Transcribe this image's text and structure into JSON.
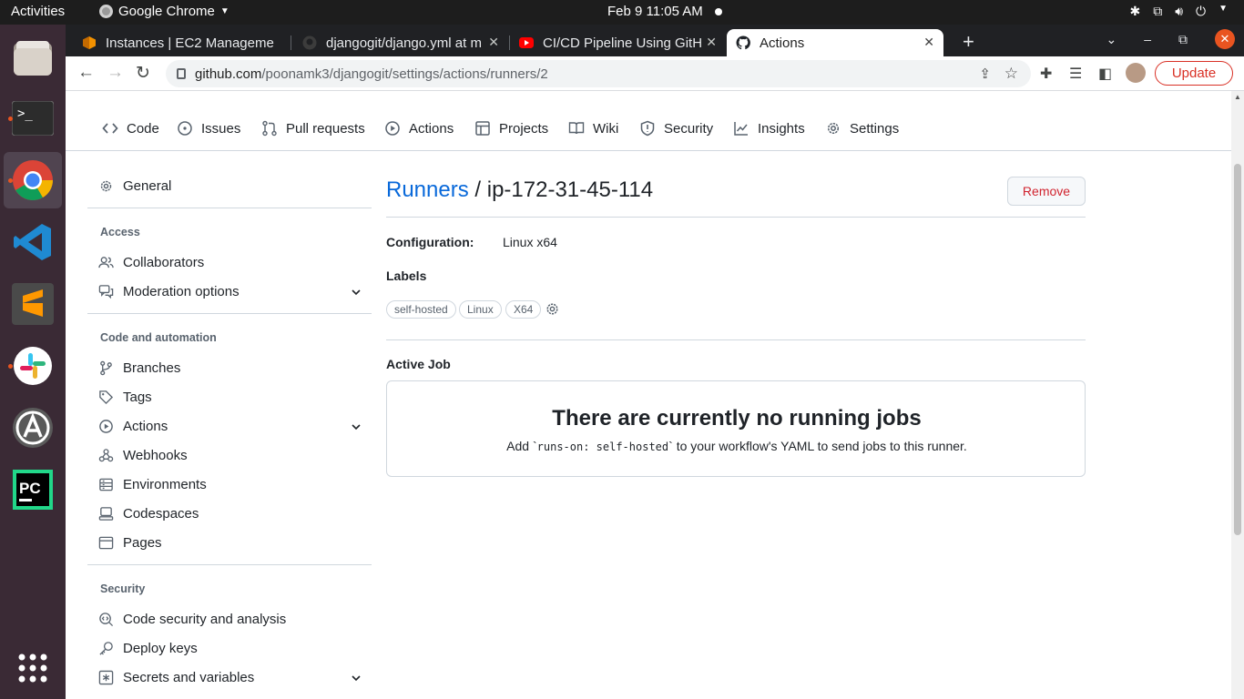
{
  "os": {
    "activities": "Activities",
    "app_menu": "Google Chrome",
    "clock": "Feb 9  11:05 AM",
    "dock": [
      "Files",
      "Terminal",
      "Google Chrome",
      "Visual Studio Code",
      "Sublime Text",
      "Slack",
      "Ubuntu Software",
      "PyCharm",
      "Show Applications"
    ]
  },
  "browser": {
    "tabs": [
      {
        "title": "Instances | EC2 Manageme",
        "icon": "aws-icon"
      },
      {
        "title": "djangogit/django.yml at m",
        "icon": "github-icon"
      },
      {
        "title": "CI/CD Pipeline Using GitH",
        "icon": "youtube-icon"
      },
      {
        "title": "Actions",
        "icon": "github-icon",
        "active": true
      }
    ],
    "url_host": "github.com",
    "url_path": "/poonamk3/djangogit/settings/actions/runners/2",
    "update_label": "Update",
    "colors": {
      "tabstrip": "#202124",
      "update": "#d93025"
    }
  },
  "repo_nav": [
    "Code",
    "Issues",
    "Pull requests",
    "Actions",
    "Projects",
    "Wiki",
    "Security",
    "Insights",
    "Settings"
  ],
  "sidebar": {
    "general": "General",
    "access_heading": "Access",
    "collaborators": "Collaborators",
    "moderation": "Moderation options",
    "code_heading": "Code and automation",
    "branches": "Branches",
    "tags": "Tags",
    "actions": "Actions",
    "webhooks": "Webhooks",
    "environments": "Environments",
    "codespaces": "Codespaces",
    "pages": "Pages",
    "security_heading": "Security",
    "code_security": "Code security and analysis",
    "deploy_keys": "Deploy keys",
    "secrets": "Secrets and variables"
  },
  "main": {
    "breadcrumb": "Runners",
    "separator": " / ",
    "runner_name": "ip-172-31-45-114",
    "remove_label": "Remove",
    "config_label": "Configuration:",
    "config_value": "Linux x64",
    "labels_heading": "Labels",
    "labels": [
      "self-hosted",
      "Linux",
      "X64"
    ],
    "active_job_heading": "Active Job",
    "empty_title": "There are currently no running jobs",
    "empty_desc_pre": "Add `",
    "empty_desc_code": "runs-on: self-hosted",
    "empty_desc_post": "` to your workflow's YAML to send jobs to this runner.",
    "colors": {
      "link": "#0969da",
      "danger": "#d1242f",
      "border": "#d0d7de"
    }
  }
}
